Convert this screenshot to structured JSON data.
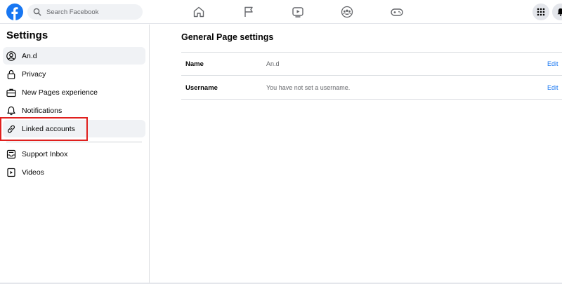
{
  "header": {
    "search_placeholder": "Search Facebook",
    "logo_icon": "facebook-logo-icon",
    "nav_icons": [
      "home-icon",
      "flag-icon",
      "watch-icon",
      "groups-icon",
      "gaming-icon"
    ],
    "right_icons": [
      "menu-grid-icon",
      "bell-icon"
    ],
    "brand_color": "#1877f2"
  },
  "sidebar": {
    "title": "Settings",
    "items": [
      {
        "label": "An.d",
        "icon": "profile-icon"
      },
      {
        "label": "Privacy",
        "icon": "lock-icon"
      },
      {
        "label": "New Pages experience",
        "icon": "briefcase-icon"
      },
      {
        "label": "Notifications",
        "icon": "bell-icon"
      },
      {
        "label": "Linked accounts",
        "icon": "link-icon"
      },
      {
        "label": "Support Inbox",
        "icon": "inbox-icon"
      },
      {
        "label": "Videos",
        "icon": "video-icon"
      }
    ]
  },
  "main": {
    "title": "General Page settings",
    "rows": [
      {
        "name": "Name",
        "value": "An.d",
        "action": "Edit"
      },
      {
        "name": "Username",
        "value": "You have not set a username.",
        "action": "Edit"
      }
    ]
  },
  "annotation": {
    "color": "#e0201e"
  }
}
